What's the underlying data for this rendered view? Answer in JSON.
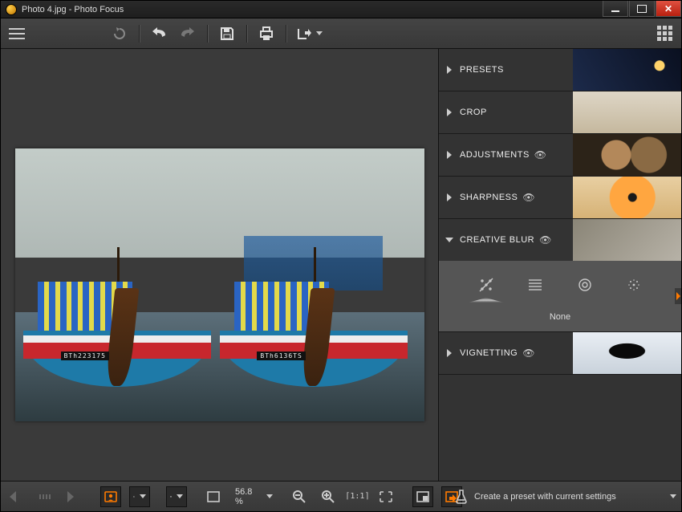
{
  "window": {
    "title": "Photo 4.jpg - Photo Focus"
  },
  "image": {
    "reg1": "BTh223175",
    "reg2": "BTh6136TS"
  },
  "panels": {
    "presets": {
      "label": "PRESETS"
    },
    "crop": {
      "label": "CROP"
    },
    "adjust": {
      "label": "ADJUSTMENTS"
    },
    "sharp": {
      "label": "SHARPNESS"
    },
    "blur": {
      "label": "CREATIVE BLUR",
      "selected": "None"
    },
    "vignette": {
      "label": "VIGNETTING"
    }
  },
  "status": {
    "zoom": "56.8 %",
    "create_preset": "Create a preset with current settings"
  }
}
